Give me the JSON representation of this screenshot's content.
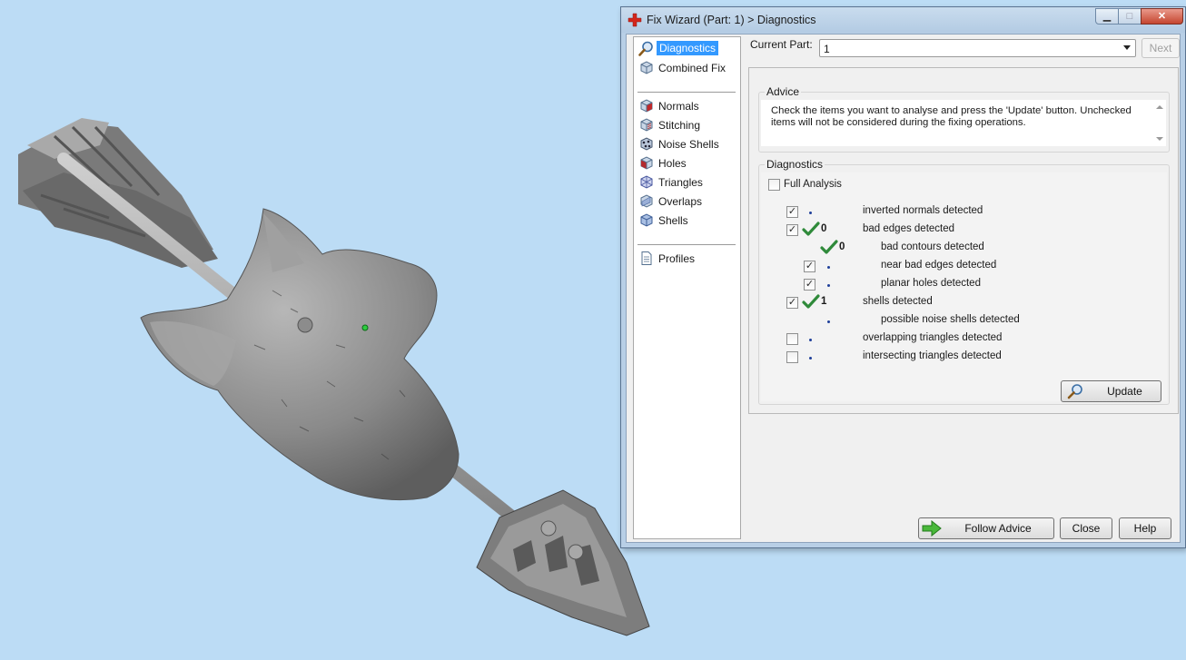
{
  "window": {
    "title": "Fix Wizard (Part: 1) > Diagnostics",
    "caption_buttons": [
      "minimize",
      "maximize",
      "close"
    ]
  },
  "nav": {
    "top_items": [
      {
        "label": "Diagnostics",
        "icon": "magnifier-icon",
        "active": true
      },
      {
        "label": "Combined Fix",
        "icon": "cube-icon",
        "active": false
      }
    ],
    "fix_items": [
      {
        "label": "Normals",
        "icon": "normals-cube-icon"
      },
      {
        "label": "Stitching",
        "icon": "stitching-cube-icon"
      },
      {
        "label": "Noise Shells",
        "icon": "noise-shells-icon"
      },
      {
        "label": "Holes",
        "icon": "holes-cube-icon"
      },
      {
        "label": "Triangles",
        "icon": "triangles-icon"
      },
      {
        "label": "Overlaps",
        "icon": "overlaps-icon"
      },
      {
        "label": "Shells",
        "icon": "shells-cube-icon"
      }
    ],
    "bottom_items": [
      {
        "label": "Profiles",
        "icon": "document-icon"
      }
    ]
  },
  "header": {
    "current_part_label": "Current Part:",
    "current_part_value": "1",
    "next_label": "Next"
  },
  "advice": {
    "title": "Advice",
    "text": "Check the items you want to analyse and press the 'Update' button. Unchecked items will not be considered during the fixing operations."
  },
  "diagnostics": {
    "title": "Diagnostics",
    "full_analysis_label": "Full Analysis",
    "full_analysis_checked": false,
    "rows": [
      {
        "label": "inverted normals detected",
        "checked": true,
        "has_checkbox": true,
        "result": "dot",
        "count": "",
        "indent": 0
      },
      {
        "label": "bad edges detected",
        "checked": true,
        "has_checkbox": true,
        "result": "ok",
        "count": "0",
        "indent": 0
      },
      {
        "label": "bad contours detected",
        "checked": false,
        "has_checkbox": false,
        "result": "ok",
        "count": "0",
        "indent": 1
      },
      {
        "label": "near bad edges detected",
        "checked": true,
        "has_checkbox": true,
        "result": "dot",
        "count": "",
        "indent": 1
      },
      {
        "label": "planar holes detected",
        "checked": true,
        "has_checkbox": true,
        "result": "dot",
        "count": "",
        "indent": 1
      },
      {
        "label": "shells detected",
        "checked": true,
        "has_checkbox": true,
        "result": "ok",
        "count": "1",
        "indent": 0
      },
      {
        "label": "possible noise shells detected",
        "checked": false,
        "has_checkbox": false,
        "result": "dot",
        "count": "",
        "indent": 1
      },
      {
        "label": "overlapping triangles detected",
        "checked": false,
        "has_checkbox": true,
        "result": "dot",
        "count": "",
        "indent": 0
      },
      {
        "label": "intersecting triangles detected",
        "checked": false,
        "has_checkbox": true,
        "result": "dot",
        "count": "",
        "indent": 0
      }
    ],
    "update_label": "Update"
  },
  "footer": {
    "follow_advice_label": "Follow Advice",
    "close_label": "Close",
    "help_label": "Help"
  },
  "colors": {
    "viewport_background": "#bcdcf5",
    "model_gray": "#8d8d8d",
    "selection_blue": "#3399ff",
    "ok_green": "#2f8a3a"
  }
}
